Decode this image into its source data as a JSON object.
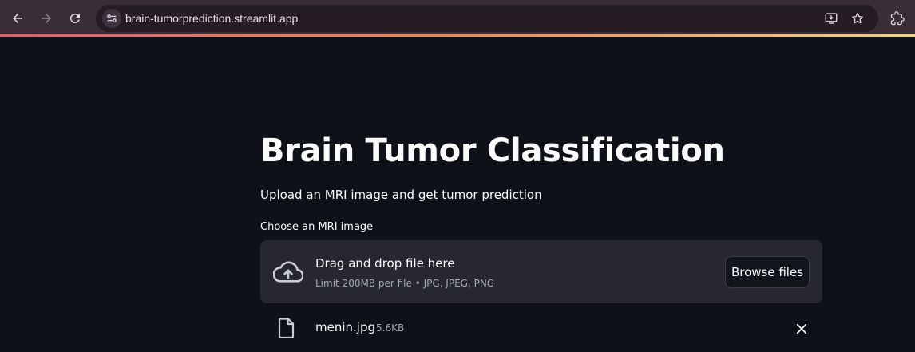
{
  "browser": {
    "url": "brain-tumorprediction.streamlit.app",
    "icons": [
      "back-icon",
      "forward-icon",
      "reload-icon",
      "site-info-icon",
      "install-app-icon",
      "bookmark-star-icon",
      "extensions-icon"
    ],
    "colors": {
      "toolbar": "#3b2d38",
      "omnibox": "#261c24"
    }
  },
  "page": {
    "title": "Brain Tumor Classification",
    "subtitle": "Upload an MRI image and get tumor prediction"
  },
  "uploader": {
    "label": "Choose an MRI image",
    "drop_title": "Drag and drop file here",
    "limit_text": "Limit 200MB per file • JPG, JPEG, PNG",
    "browse_label": "Browse files",
    "icon": "cloud-upload-icon"
  },
  "uploaded_file": {
    "name": "menin.jpg",
    "size": "5.6KB",
    "icon": "file-icon",
    "remove_icon": "close-icon"
  },
  "colors": {
    "background": "#0e1117",
    "dropzone": "#262730",
    "text": "#fafafa",
    "muted": "#a3a8b8"
  }
}
